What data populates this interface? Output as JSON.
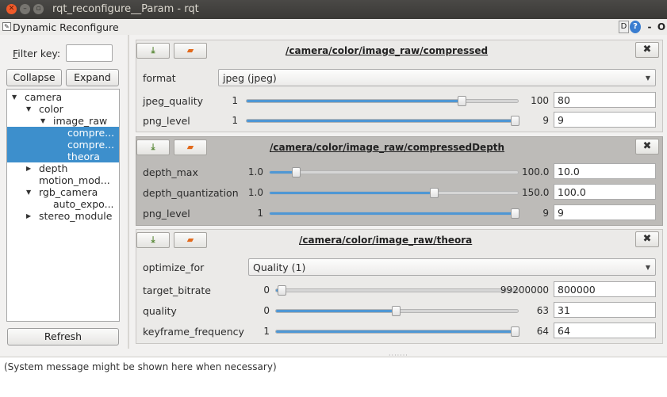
{
  "window": {
    "title": "rqt_reconfigure__Param - rqt"
  },
  "plugin": {
    "title": "Dynamic Reconfigure",
    "btn_d": "D",
    "btn_help": "?",
    "btn_dash": "-",
    "btn_o": "O"
  },
  "sidebar": {
    "filter_label": "Filter key:",
    "filter_value": "",
    "collapse_label": "Collapse all",
    "expand_label": "Expand all",
    "refresh_label": "Refresh",
    "tree": [
      {
        "label": "camera",
        "expanded": true,
        "selected": false
      },
      {
        "label": "color",
        "expanded": true,
        "selected": false
      },
      {
        "label": "image_raw",
        "expanded": true,
        "selected": false
      },
      {
        "label": "compre...",
        "selected": true
      },
      {
        "label": "compre...",
        "selected": true
      },
      {
        "label": "theora",
        "selected": true
      },
      {
        "label": "depth",
        "expanded": false,
        "selected": false
      },
      {
        "label": "motion_mod...",
        "selected": false
      },
      {
        "label": "rgb_camera",
        "expanded": true,
        "selected": false
      },
      {
        "label": "auto_expo...",
        "selected": false
      },
      {
        "label": "stereo_module",
        "expanded": false,
        "selected": false
      }
    ]
  },
  "panels": [
    {
      "title": "/camera/color/image_raw/compressed",
      "params": [
        {
          "name": "format",
          "type": "enum",
          "value": "jpeg (jpeg)"
        },
        {
          "name": "jpeg_quality",
          "type": "int",
          "min": "1",
          "max": "100",
          "value": "80",
          "fraction": 0.798
        },
        {
          "name": "png_level",
          "type": "int",
          "min": "1",
          "max": "9",
          "value": "9",
          "fraction": 1.0
        }
      ]
    },
    {
      "title": "/camera/color/image_raw/compressedDepth",
      "params": [
        {
          "name": "depth_max",
          "type": "double",
          "min": "1.0",
          "max": "100.0",
          "value": "10.0",
          "fraction": 0.091
        },
        {
          "name": "depth_quantization",
          "type": "double",
          "min": "1.0",
          "max": "150.0",
          "value": "100.0",
          "fraction": 0.664
        },
        {
          "name": "png_level",
          "type": "int",
          "min": "1",
          "max": "9",
          "value": "9",
          "fraction": 1.0
        }
      ]
    },
    {
      "title": "/camera/color/image_raw/theora",
      "params": [
        {
          "name": "optimize_for",
          "type": "enum",
          "value": "Quality (1)"
        },
        {
          "name": "target_bitrate",
          "type": "int",
          "min": "0",
          "max": "99200000",
          "value": "800000",
          "fraction": 0.008
        },
        {
          "name": "quality",
          "type": "int",
          "min": "0",
          "max": "63",
          "value": "31",
          "fraction": 0.492
        },
        {
          "name": "keyframe_frequency",
          "type": "int",
          "min": "1",
          "max": "64",
          "value": "64",
          "fraction": 1.0
        }
      ]
    }
  ],
  "status": {
    "message": "(System message might be shown here when necessary)"
  },
  "colors": {
    "accent": "#4f97d4",
    "selection": "#3d8fcc",
    "active_panel": "#bdbbb8"
  },
  "icons": {
    "load": "download-icon",
    "save": "folder-icon",
    "close": "close-icon"
  }
}
